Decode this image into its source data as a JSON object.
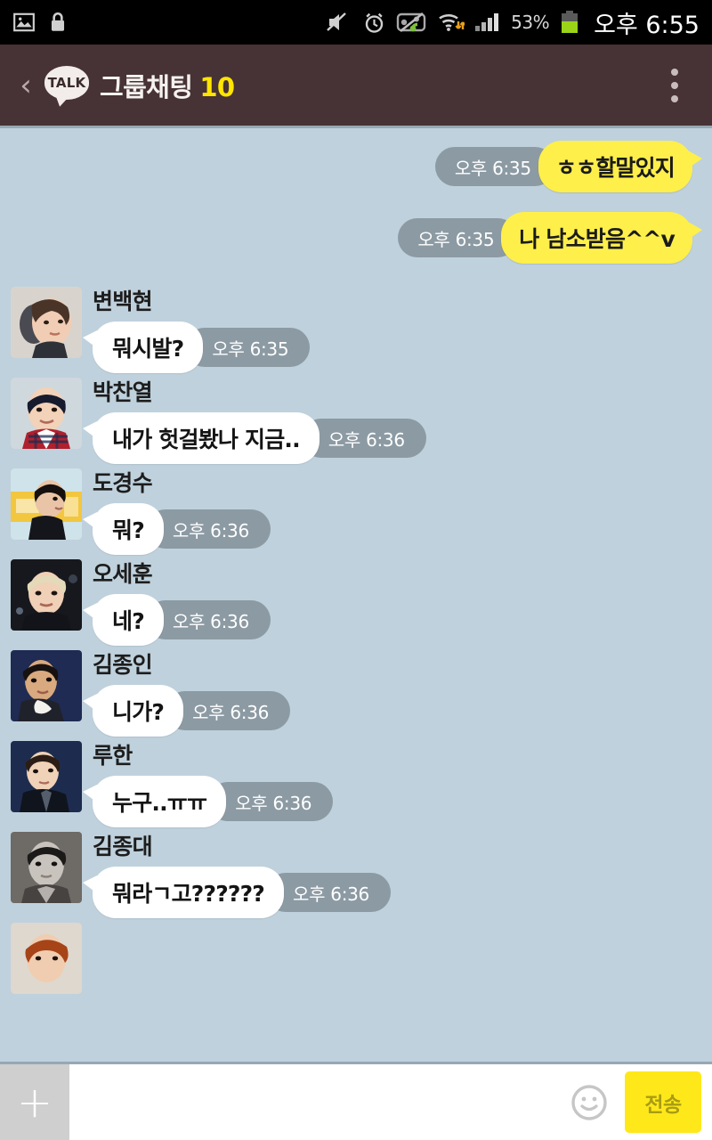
{
  "statusbar": {
    "time": "오후 6:55",
    "battery_percent": "53%",
    "icons": [
      "image-icon",
      "lock-icon",
      "mute-icon",
      "alarm-icon",
      "sync-off-icon",
      "wifi-icon",
      "signal-icon",
      "battery-icon"
    ]
  },
  "header": {
    "back_label": "‹",
    "logo_text": "TALK",
    "title": "그룹채팅",
    "member_count": "10",
    "menu_label": "more-options"
  },
  "messages": [
    {
      "id": "m1",
      "direction": "out",
      "text": "ㅎㅎ할말있지",
      "time": "오후 6:35"
    },
    {
      "id": "m2",
      "direction": "out",
      "text": "나 남소받음^^v",
      "time": "오후 6:35"
    },
    {
      "id": "m3",
      "direction": "in",
      "sender": "변백현",
      "text": "뭐시발?",
      "time": "오후 6:35",
      "avatar": "baekhyun"
    },
    {
      "id": "m4",
      "direction": "in",
      "sender": "박찬열",
      "text": "내가 헛걸봤나 지금..",
      "time": "오후 6:36",
      "avatar": "chanyeol"
    },
    {
      "id": "m5",
      "direction": "in",
      "sender": "도경수",
      "text": "뭐?",
      "time": "오후 6:36",
      "avatar": "kyungsoo"
    },
    {
      "id": "m6",
      "direction": "in",
      "sender": "오세훈",
      "text": "네?",
      "time": "오후 6:36",
      "avatar": "sehun"
    },
    {
      "id": "m7",
      "direction": "in",
      "sender": "김종인",
      "text": "니가?",
      "time": "오후 6:36",
      "avatar": "jongin"
    },
    {
      "id": "m8",
      "direction": "in",
      "sender": "루한",
      "text": "누구..ㅠㅠ",
      "time": "오후 6:36",
      "avatar": "luhan"
    },
    {
      "id": "m9",
      "direction": "in",
      "sender": "김종대",
      "text": "뭐라ㄱ고??????",
      "time": "오후 6:36",
      "avatar": "jongdae"
    }
  ],
  "partial_message": {
    "sender": "",
    "avatar": "partial"
  },
  "inputbar": {
    "attach_label": "+",
    "placeholder": "",
    "value": "",
    "emoji_label": "emoticon",
    "send_label": "전송"
  },
  "colors": {
    "header_bg": "#473235",
    "chat_bg": "#bfd1dc",
    "out_bubble": "#ffef4a",
    "in_bubble": "#ffffff",
    "timestamp_pill": "#8c9aa3",
    "send_button": "#ffe81a",
    "accent_yellow": "#ffe500"
  }
}
